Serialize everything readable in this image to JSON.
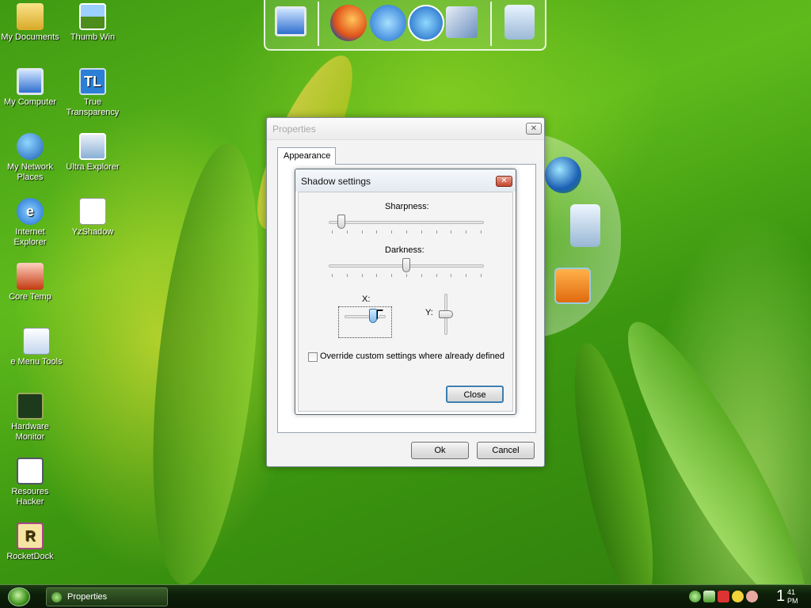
{
  "desktop": {
    "icons": [
      {
        "label": "My Documents",
        "icon": "folder-icon"
      },
      {
        "label": "Thumb Win",
        "icon": "photo-icon"
      },
      {
        "label": "My Computer",
        "icon": "computer-icon"
      },
      {
        "label": "True Transparency",
        "icon": "tl-icon",
        "glyph": "TL"
      },
      {
        "label": "My Network Places",
        "icon": "network-icon"
      },
      {
        "label": "Ultra Explorer",
        "icon": "ultra-explorer-icon"
      },
      {
        "label": "Internet Explorer",
        "icon": "ie-icon",
        "glyph": "e"
      },
      {
        "label": "YzShadow",
        "icon": "yzshadow-icon"
      },
      {
        "label": "Core Temp",
        "icon": "core-temp-icon"
      },
      {
        "label": "e Menu Tools",
        "icon": "menu-tools-icon"
      },
      {
        "label": "Hardware Monitor",
        "icon": "hardware-monitor-icon"
      },
      {
        "label": "Resoures Hacker",
        "icon": "resource-hacker-icon"
      },
      {
        "label": "RocketDock",
        "icon": "rocketdock-icon",
        "glyph": "R"
      }
    ]
  },
  "dock": {
    "items": [
      "computer-icon",
      "firefox-icon",
      "ie-icon",
      "media-player-icon",
      "control-panel-icon",
      "recycle-bin-icon"
    ]
  },
  "ring_dock": {
    "items": [
      "globe-icon",
      "recycle-bin-icon",
      "media-player-icon"
    ]
  },
  "properties_window": {
    "title": "Properties",
    "close_glyph": "✕",
    "tab": "Appearance",
    "ok_label": "Ok",
    "cancel_label": "Cancel"
  },
  "shadow_dialog": {
    "title": "Shadow settings",
    "close_glyph": "✕",
    "sharpness_label": "Sharpness:",
    "darkness_label": "Darkness:",
    "x_label": "X:",
    "y_label": "Y:",
    "sharpness_value": 0.08,
    "darkness_value": 0.5,
    "x_value": 0.7,
    "y_value": 0.5,
    "override_label": "Override custom settings where already defined",
    "override_checked": false,
    "close_label": "Close"
  },
  "taskbar": {
    "task_label": "Properties",
    "clock_hour": "1",
    "clock_minute": "41",
    "clock_ampm": "PM"
  },
  "colors": {
    "desktop_green": "#4aa516",
    "taskbar": "#0d1f09",
    "close_red": "#c4452c"
  }
}
